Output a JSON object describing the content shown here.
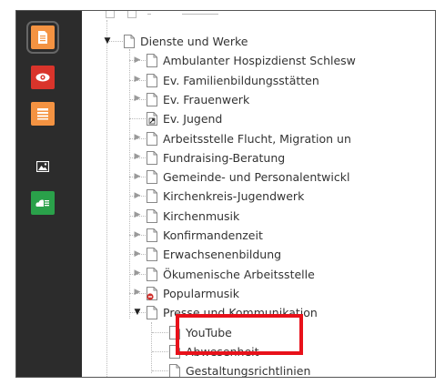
{
  "sidebar": {
    "items": [
      {
        "name": "page-module-icon",
        "class": "page"
      },
      {
        "name": "view-module-icon",
        "class": "view"
      },
      {
        "name": "list-module-icon",
        "class": "list"
      },
      {
        "name": "media-module-icon",
        "class": "media"
      },
      {
        "name": "forms-module-icon",
        "class": "forms"
      }
    ]
  },
  "tree": {
    "rows": [
      {
        "label": "Dienste und Werke",
        "level": 0,
        "toggle": "open",
        "icon": "page"
      },
      {
        "label": "Ambulanter Hospizdienst Schlesw",
        "level": 1,
        "toggle": "closed",
        "icon": "page"
      },
      {
        "label": "Ev. Familienbildungsstätten",
        "level": 1,
        "toggle": "closed",
        "icon": "page"
      },
      {
        "label": "Ev. Frauenwerk",
        "level": 1,
        "toggle": "closed",
        "icon": "page"
      },
      {
        "label": "Ev. Jugend",
        "level": 1,
        "toggle": "none",
        "icon": "shortcut"
      },
      {
        "label": "Arbeitsstelle Flucht, Migration un",
        "level": 1,
        "toggle": "closed",
        "icon": "page"
      },
      {
        "label": "Fundraising-Beratung",
        "level": 1,
        "toggle": "closed",
        "icon": "page"
      },
      {
        "label": "Gemeinde- und Personalentwickl",
        "level": 1,
        "toggle": "closed",
        "icon": "page"
      },
      {
        "label": "Kirchenkreis-Jugendwerk",
        "level": 1,
        "toggle": "closed",
        "icon": "page"
      },
      {
        "label": "Kirchenmusik",
        "level": 1,
        "toggle": "closed",
        "icon": "page"
      },
      {
        "label": "Konfirmandenzeit",
        "level": 1,
        "toggle": "closed",
        "icon": "page"
      },
      {
        "label": "Erwachsenenbildung",
        "level": 1,
        "toggle": "closed",
        "icon": "page"
      },
      {
        "label": "Ökumenische Arbeitsstelle",
        "level": 1,
        "toggle": "closed",
        "icon": "page"
      },
      {
        "label": "Popularmusik",
        "level": 1,
        "toggle": "closed",
        "icon": "page-restricted"
      },
      {
        "label": "Presse und Kommunikation",
        "level": 1,
        "toggle": "open",
        "icon": "page"
      },
      {
        "label": "YouTube",
        "level": 2,
        "toggle": "none",
        "icon": "page"
      },
      {
        "label": "Abwesenheit",
        "level": 2,
        "toggle": "none",
        "icon": "page"
      },
      {
        "label": "Gestaltungsrichtlinien",
        "level": 2,
        "toggle": "none",
        "icon": "page"
      }
    ]
  },
  "colors": {
    "highlight": "#e8111a",
    "sidebar_bg": "#2c2c2c",
    "orange": "#f49342",
    "red": "#d9342b",
    "green": "#2aa14a"
  }
}
